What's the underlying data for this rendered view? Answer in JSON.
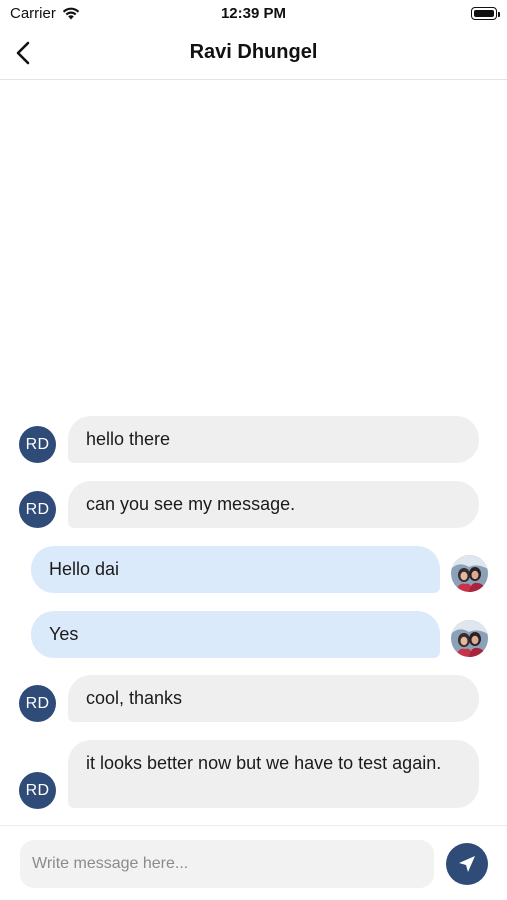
{
  "status_bar": {
    "carrier": "Carrier",
    "time": "12:39 PM"
  },
  "header": {
    "title": "Ravi Dhungel"
  },
  "contact_initials": "RD",
  "messages": [
    {
      "text": "hello there",
      "from": "contact"
    },
    {
      "text": "can you see my message.",
      "from": "contact"
    },
    {
      "text": "Hello dai",
      "from": "me"
    },
    {
      "text": "Yes",
      "from": "me"
    },
    {
      "text": "cool, thanks",
      "from": "contact"
    },
    {
      "text": "it looks better now but we have to test again.",
      "from": "contact"
    }
  ],
  "composer": {
    "placeholder": "Write message here..."
  },
  "colors": {
    "accent": "#2f4b78",
    "incoming_bubble": "#efefef",
    "outgoing_bubble": "#dbeafb"
  },
  "icons": {
    "back": "chevron-left-icon",
    "send": "send-arrow-icon",
    "wifi": "wifi-icon",
    "battery": "battery-icon"
  }
}
